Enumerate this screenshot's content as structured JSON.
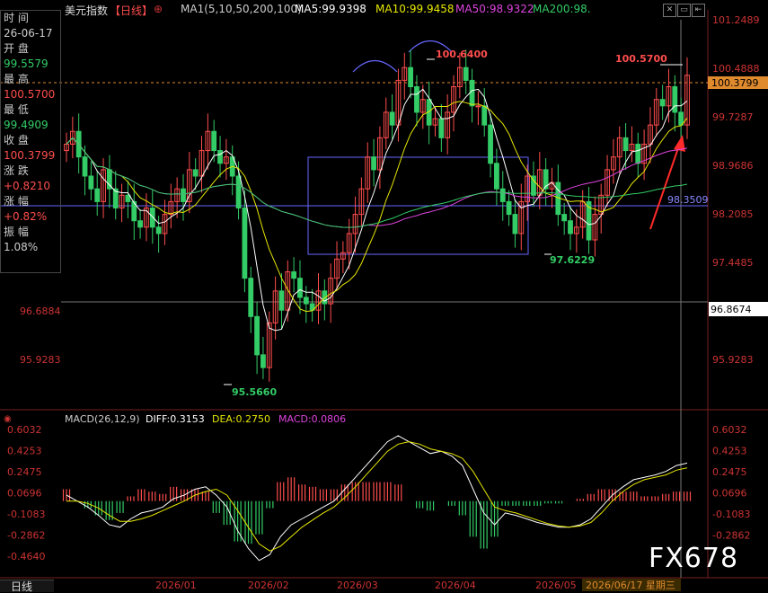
{
  "header": {
    "symbol": "美元指数",
    "period": "【日线】",
    "ma_set": "MA1(5,10,50,200,100)",
    "ma5": "MA5:99.9398",
    "ma10": "MA10:99.9458",
    "ma50": "MA50:98.9322",
    "ma200": "MA200:98."
  },
  "side_panel": {
    "time_label": "时 间",
    "time_value": "26-06-17",
    "open_label": "开 盘",
    "open_value": "99.5579",
    "high_label": "最 高",
    "high_value": "100.5700",
    "low_label": "最 低",
    "low_value": "99.4909",
    "close_label": "收 盘",
    "close_value": "100.3799",
    "change_label": "涨 跌",
    "change_value": "+0.8210",
    "pct_label": "涨 幅",
    "pct_value": "+0.82%",
    "amp_label": "振 幅",
    "amp_value": "1.08%"
  },
  "price_axis": {
    "right_ticks": [
      "101.2489",
      "100.4888",
      "99.7287",
      "98.9686",
      "98.2085",
      "97.4485",
      "96.8674",
      "95.9283"
    ],
    "left_ticks": [
      "96.6884",
      "95.9283"
    ],
    "current_price_label": "100.3799"
  },
  "annotations": {
    "high_a": "100.6400",
    "high_b": "100.5700",
    "low_a": "95.5660",
    "low_b": "97.6229",
    "hline": "98.3509"
  },
  "macd": {
    "title": "MACD(26,12,9)",
    "diff": "DIFF:0.3153",
    "dea": "DEA:0.2750",
    "macd": "MACD:0.0806",
    "ticks": [
      "0.6032",
      "0.4253",
      "0.2475",
      "0.0696",
      "-0.1083",
      "-0.2862",
      "-0.4640"
    ]
  },
  "x_axis": [
    "2026/01",
    "2026/02",
    "2026/03",
    "2026/04",
    "2026/05"
  ],
  "date_label": "2026/06/17 星期三",
  "bottom_tab": "日线",
  "watermark": "FX678",
  "colors": {
    "up": "#ff4d4d",
    "down": "#33cc66",
    "ma5": "#ffffff",
    "ma10": "#e6e600",
    "ma50": "#dd44dd",
    "ma200": "#33cc66",
    "ma100": "#9999ff",
    "axis": "#cc3333"
  },
  "chart_data": [
    {
      "type": "candlestick",
      "title": "美元指数【日线】",
      "ylim": [
        95.5,
        101.3
      ],
      "x_range": [
        "2025-12-01",
        "2026-06-17"
      ],
      "series_note": "approximate daily closes read from the chart",
      "close": [
        99.3,
        99.5,
        99.1,
        98.8,
        98.6,
        98.4,
        98.9,
        98.6,
        98.3,
        98.5,
        98.4,
        98.1,
        98.0,
        98.3,
        98.0,
        97.9,
        98.2,
        98.4,
        98.6,
        98.4,
        98.9,
        98.8,
        99.2,
        99.5,
        99.2,
        99.0,
        99.1,
        98.8,
        98.3,
        97.2,
        96.6,
        96.0,
        95.8,
        96.5,
        97.0,
        96.7,
        97.3,
        97.2,
        96.9,
        96.8,
        96.7,
        97.0,
        96.8,
        97.2,
        97.5,
        97.6,
        97.9,
        98.2,
        98.6,
        99.1,
        98.9,
        99.4,
        99.8,
        99.6,
        100.3,
        100.5,
        100.2,
        99.8,
        100.0,
        99.6,
        99.7,
        99.4,
        99.8,
        100.2,
        100.5,
        100.3,
        99.9,
        99.9,
        99.6,
        99.0,
        98.6,
        98.4,
        98.2,
        97.9,
        98.4,
        98.8,
        98.5,
        98.9,
        98.6,
        98.7,
        98.2,
        98.1,
        97.9,
        98.0,
        98.4,
        97.8,
        98.2,
        98.5,
        98.9,
        99.1,
        99.4,
        99.2,
        99.3,
        99.0,
        99.3,
        99.6,
        100.0,
        99.9,
        100.2,
        99.8,
        99.6,
        100.38
      ],
      "ma_values": {
        "MA5": 99.9398,
        "MA10": 99.9458,
        "MA50": 98.9322
      },
      "ohlc_last": {
        "date": "26-06-17",
        "open": 99.5579,
        "high": 100.57,
        "low": 99.4909,
        "close": 100.3799
      }
    },
    {
      "type": "macd",
      "title": "MACD(26,12,9)",
      "ylim": [
        -0.55,
        0.62
      ],
      "diff": [
        0.05,
        0.0,
        -0.05,
        -0.12,
        -0.2,
        -0.22,
        -0.15,
        -0.1,
        -0.08,
        -0.05,
        0.02,
        0.05,
        0.1,
        0.12,
        0.05,
        -0.05,
        -0.25,
        -0.4,
        -0.5,
        -0.45,
        -0.3,
        -0.2,
        -0.15,
        -0.1,
        -0.05,
        0.0,
        0.1,
        0.2,
        0.3,
        0.4,
        0.5,
        0.55,
        0.5,
        0.45,
        0.4,
        0.42,
        0.38,
        0.3,
        0.1,
        -0.1,
        -0.2,
        -0.1,
        -0.12,
        -0.15,
        -0.18,
        -0.2,
        -0.22,
        -0.22,
        -0.2,
        -0.15,
        -0.05,
        0.05,
        0.12,
        0.18,
        0.2,
        0.22,
        0.25,
        0.3,
        0.32
      ],
      "dea": [
        0.0,
        0.0,
        -0.02,
        -0.06,
        -0.12,
        -0.17,
        -0.17,
        -0.15,
        -0.12,
        -0.08,
        -0.04,
        0.0,
        0.05,
        0.08,
        0.1,
        0.05,
        -0.08,
        -0.22,
        -0.36,
        -0.42,
        -0.38,
        -0.3,
        -0.22,
        -0.16,
        -0.1,
        -0.05,
        0.03,
        0.12,
        0.22,
        0.32,
        0.42,
        0.48,
        0.5,
        0.48,
        0.44,
        0.42,
        0.4,
        0.36,
        0.25,
        0.1,
        -0.05,
        -0.08,
        -0.1,
        -0.13,
        -0.16,
        -0.19,
        -0.21,
        -0.22,
        -0.21,
        -0.18,
        -0.1,
        0.0,
        0.08,
        0.14,
        0.18,
        0.2,
        0.22,
        0.26,
        0.28
      ]
    }
  ]
}
